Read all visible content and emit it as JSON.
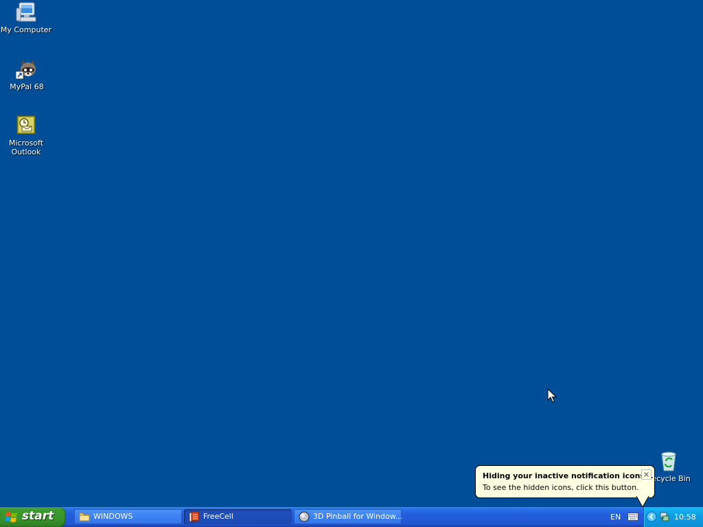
{
  "desktop": {
    "background_color": "#004e98",
    "icons": [
      {
        "label": "My Computer",
        "icon": "my-computer-icon"
      },
      {
        "label": "MyPal 68",
        "icon": "mypal-raccoon-icon"
      },
      {
        "label": "Microsoft Outlook",
        "icon": "outlook-icon"
      },
      {
        "label": "Recycle Bin",
        "icon": "recycle-bin-icon"
      }
    ]
  },
  "taskbar": {
    "start_label": "start",
    "tasks": [
      {
        "label": "WINDOWS",
        "icon": "folder-icon",
        "active": false
      },
      {
        "label": "FreeCell",
        "icon": "freecell-icon",
        "active": true
      },
      {
        "label": "3D Pinball for Window...",
        "icon": "pinball-icon",
        "active": false
      }
    ]
  },
  "tray": {
    "language": "EN",
    "clock": "10:58",
    "icons": [
      "keyboard-icon",
      "show-hidden-icons-arrow-icon",
      "network-icon"
    ]
  },
  "balloon": {
    "title": "Hiding your inactive notification icons...",
    "text": "To see the hidden icons, click this button."
  }
}
